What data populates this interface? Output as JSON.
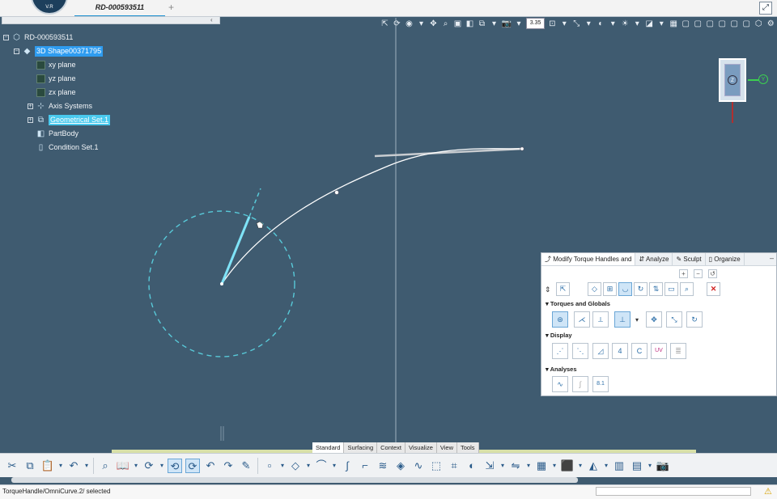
{
  "app": {
    "logo_text": "V.R"
  },
  "tabs": {
    "document": "RD-000593511",
    "new_tab": "+"
  },
  "view_toolbar": {
    "zoom_value": "3.35"
  },
  "tree": [
    {
      "label": "RD-000593511",
      "icon": "product-icon",
      "expander": "−",
      "state": "normal"
    },
    {
      "label": "3D Shape00371795",
      "icon": "shape-icon",
      "expander": "−",
      "state": "selected"
    },
    {
      "label": "xy plane",
      "icon": "plane-icon",
      "state": "normal"
    },
    {
      "label": "yz plane",
      "icon": "plane-icon",
      "state": "normal"
    },
    {
      "label": "zx plane",
      "icon": "plane-icon",
      "state": "normal"
    },
    {
      "label": "Axis Systems",
      "icon": "axis-system-icon",
      "expander": "+",
      "state": "normal"
    },
    {
      "label": "Geometrical Set.1",
      "icon": "geometrical-set-icon",
      "expander": "+",
      "state": "highlighted"
    },
    {
      "label": "PartBody",
      "icon": "part-body-icon",
      "state": "normal"
    },
    {
      "label": "Condition Set.1",
      "icon": "condition-set-icon",
      "state": "normal"
    }
  ],
  "compass": {
    "z_label": "Z",
    "y_label": "Y"
  },
  "panel": {
    "tabs": [
      "Modify Torque Handles and",
      "Analyze",
      "Sculpt",
      "Organize"
    ],
    "active_tab": "Modify Torque Handles and",
    "sections": [
      "Torques and Globals",
      "Display",
      "Analyses"
    ]
  },
  "bottom_tabs": [
    "Standard",
    "Surfacing",
    "Context",
    "Visualize",
    "View",
    "Tools"
  ],
  "active_bottom_tab": "Standard",
  "status": {
    "text": "TorqueHandle/OmniCurve.2/ selected"
  },
  "colors": {
    "background": "#3f5b70",
    "curve": "#ffffff",
    "handle": "#7fe3f7",
    "dashed_circle": "#58c9d8",
    "selection": "#2e9cf0"
  }
}
